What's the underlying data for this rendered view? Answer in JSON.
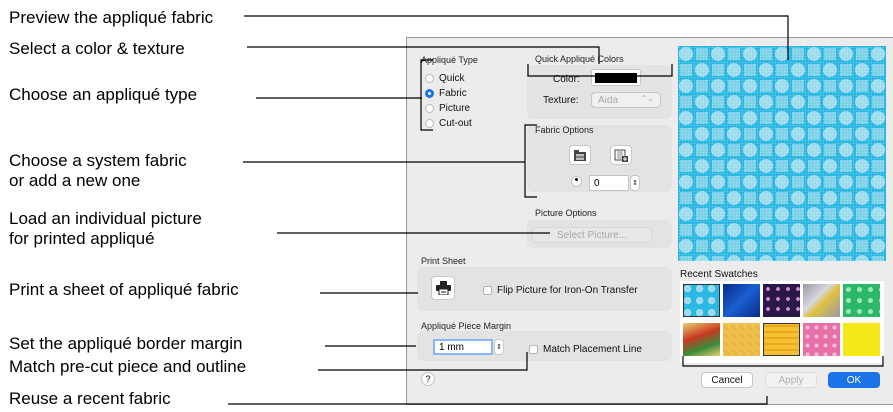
{
  "callouts": [
    "Preview the appliqué fabric",
    "Select a color & texture",
    "Choose an appliqué type",
    "Choose a system fabric",
    "or add a new one",
    "Load an individual picture",
    "for printed appliqué",
    "Print a sheet of appliqué fabric",
    "Set the appliqué border margin",
    "Match pre-cut piece and outline",
    "Reuse a recent fabric"
  ],
  "applique_type": {
    "title": "Appliqué Type",
    "options": [
      "Quick",
      "Fabric",
      "Picture",
      "Cut-out"
    ],
    "selected": "Fabric"
  },
  "quick_colors": {
    "title": "Quick Appliqué Colors",
    "color_label": "Color:",
    "color_value": "#000000",
    "texture_label": "Texture:",
    "texture_value": "Aida"
  },
  "fabric_options": {
    "title": "Fabric Options",
    "stepper_value": "0"
  },
  "picture_options": {
    "title": "Picture Options",
    "select_button": "Select Picture..."
  },
  "print_sheet": {
    "title": "Print Sheet",
    "flip_label": "Flip Picture for Iron-On Transfer"
  },
  "margin": {
    "title": "Appliqué Piece Margin",
    "value": "1 mm",
    "match_label": "Match Placement Line"
  },
  "recent_swatches_title": "Recent Swatches",
  "buttons": {
    "help": "?",
    "cancel": "Cancel",
    "apply": "Apply",
    "ok": "OK"
  },
  "colors": {
    "accent": "#1a73e8",
    "preview_fabric": "#2bb8e3"
  }
}
